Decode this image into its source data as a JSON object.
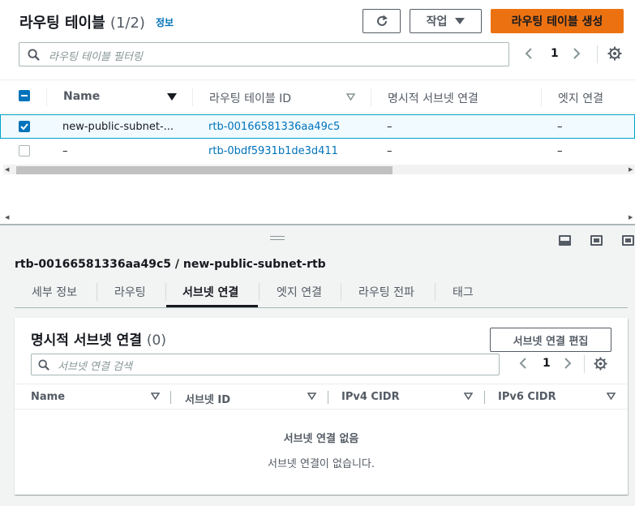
{
  "header": {
    "title": "라우팅 테이블",
    "count": "(1/2)",
    "info_link": "정보",
    "actions_label": "작업",
    "create_label": "라우팅 테이블 생성"
  },
  "filter": {
    "placeholder": "라우팅 테이블 필터링"
  },
  "pagination": {
    "page": "1"
  },
  "table": {
    "columns": [
      "Name",
      "라우팅 테이블 ID",
      "명시적 서브넷 연결",
      "엣지 연결"
    ],
    "rows": [
      {
        "name": "new-public-subnet-...",
        "id": "rtb-00166581336aa49c5",
        "explicit": "–",
        "edge": "–",
        "selected": true
      },
      {
        "name": "–",
        "id": "rtb-0bdf5931b1de3d411",
        "explicit": "–",
        "edge": "–",
        "selected": false
      }
    ]
  },
  "detail": {
    "title": "rtb-00166581336aa49c5 / new-public-subnet-rtb",
    "tabs": [
      "세부 정보",
      "라우팅",
      "서브넷 연결",
      "엣지 연결",
      "라우팅 전파",
      "태그"
    ],
    "active_tab": "서브넷 연결"
  },
  "subnet_panel": {
    "title": "명시적 서브넷 연결",
    "count": "(0)",
    "edit_label": "서브넷 연결 편집",
    "search_placeholder": "서브넷 연결 검색",
    "page": "1",
    "columns": [
      "Name",
      "서브넷 ID",
      "IPv4 CIDR",
      "IPv6 CIDR"
    ],
    "empty_title": "서브넷 연결 없음",
    "empty_message": "서브넷 연결이 없습니다."
  },
  "colors": {
    "primary": "#ec7211",
    "link": "#0073bb",
    "selected_row": "#f1faff"
  }
}
